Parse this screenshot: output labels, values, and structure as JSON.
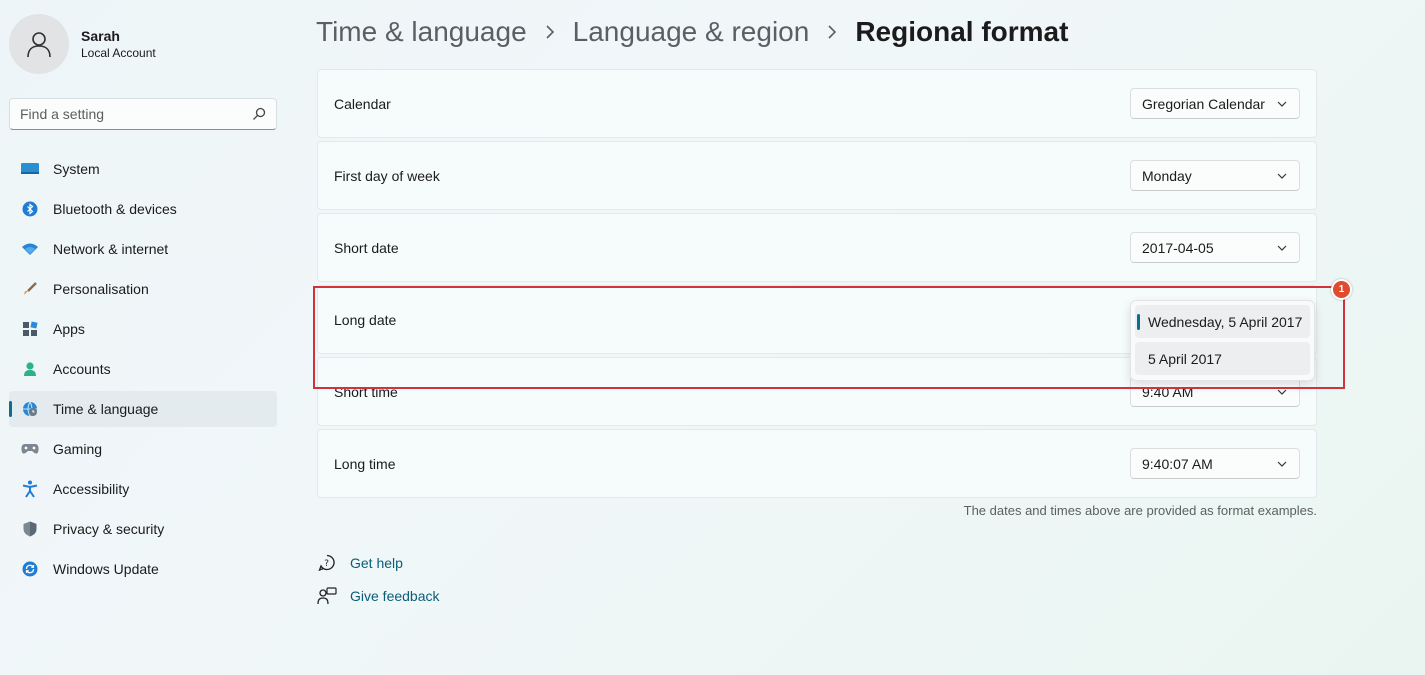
{
  "profile": {
    "name": "Sarah",
    "account_type": "Local Account"
  },
  "search": {
    "placeholder": "Find a setting"
  },
  "sidebar": {
    "items": [
      {
        "label": "System",
        "icon": "monitor-icon"
      },
      {
        "label": "Bluetooth & devices",
        "icon": "bluetooth-icon"
      },
      {
        "label": "Network & internet",
        "icon": "wifi-icon"
      },
      {
        "label": "Personalisation",
        "icon": "brush-icon"
      },
      {
        "label": "Apps",
        "icon": "apps-icon"
      },
      {
        "label": "Accounts",
        "icon": "person-icon"
      },
      {
        "label": "Time & language",
        "icon": "globe-clock-icon",
        "active": true
      },
      {
        "label": "Gaming",
        "icon": "gamepad-icon"
      },
      {
        "label": "Accessibility",
        "icon": "accessibility-icon"
      },
      {
        "label": "Privacy & security",
        "icon": "shield-icon"
      },
      {
        "label": "Windows Update",
        "icon": "update-icon"
      }
    ]
  },
  "breadcrumb": {
    "level1": "Time & language",
    "level2": "Language & region",
    "current": "Regional format"
  },
  "settings": [
    {
      "label": "Calendar",
      "value": "Gregorian Calendar"
    },
    {
      "label": "First day of week",
      "value": "Monday"
    },
    {
      "label": "Short date",
      "value": "2017-04-05"
    },
    {
      "label": "Long date",
      "value": ""
    },
    {
      "label": "Short time",
      "value": "9:40 AM"
    },
    {
      "label": "Long time",
      "value": "9:40:07 AM"
    }
  ],
  "long_date_flyout": {
    "options": [
      "Wednesday, 5 April 2017",
      "5 April 2017"
    ],
    "selected_index": 0
  },
  "footnote": "The dates and times above are provided as format examples.",
  "links": {
    "help": "Get help",
    "feedback": "Give feedback"
  },
  "annotation": {
    "badge": "1",
    "color": "#d0343a"
  },
  "colors": {
    "accent": "#0f6e8c",
    "link": "#0b5d77"
  }
}
